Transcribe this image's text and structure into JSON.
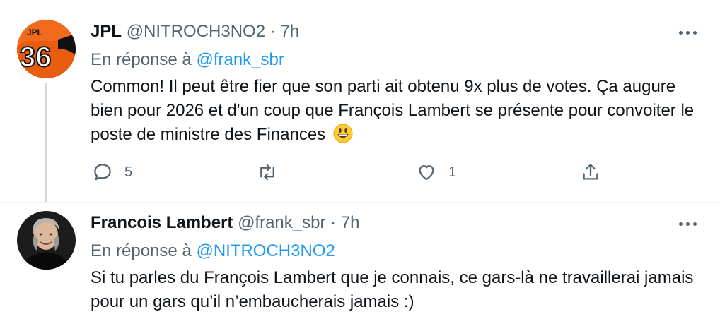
{
  "tweets": [
    {
      "display_name": "JPL",
      "handle": "@NITROCH3NO2",
      "separator": "·",
      "time": "7h",
      "reply_prefix": "En réponse à",
      "reply_to": "@frank_sbr",
      "text": "Common!  Il peut être fier que son parti ait obtenu 9x plus de votes.  Ça augure bien pour 2026 et d'un coup que François Lambert se présente pour convoiter le poste de ministre des Finances",
      "emoji": "grinning-face",
      "avatar_jersey_name": "JPL",
      "avatar_jersey_number": "36",
      "actions": {
        "reply_count": "5",
        "retweet_count": "",
        "like_count": "1"
      }
    },
    {
      "display_name": "Francois Lambert",
      "handle": "@frank_sbr",
      "separator": "·",
      "time": "7h",
      "reply_prefix": "En réponse à",
      "reply_to": "@NITROCH3NO2",
      "text": "Si tu parles du François Lambert que je connais, ce gars-là ne travaillerai jamais pour un gars qu’il n’embaucherais jamais :)"
    }
  ],
  "colors": {
    "text": "#0f1419",
    "secondary": "#536471",
    "link": "#1d9bf0",
    "thread_line": "#cfd9de",
    "avatar1_orange": "#f26b1d"
  }
}
